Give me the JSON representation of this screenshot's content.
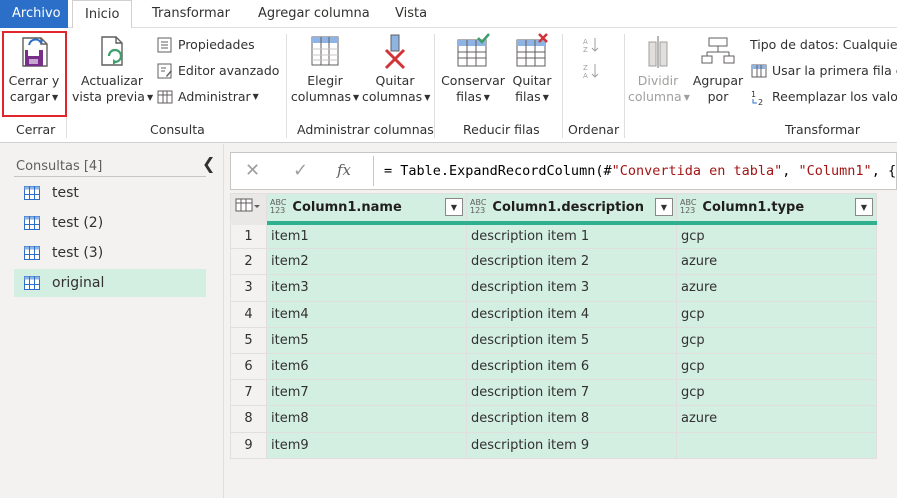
{
  "tabs": [
    {
      "label": "Archivo"
    },
    {
      "label": "Inicio"
    },
    {
      "label": "Transformar"
    },
    {
      "label": "Agregar columna"
    },
    {
      "label": "Vista"
    }
  ],
  "ribbon": {
    "close_load": {
      "line1": "Cerrar y",
      "line2": "cargar"
    },
    "refresh": {
      "line1": "Actualizar",
      "line2": "vista previa"
    },
    "properties": "Propiedades",
    "advanced_editor": "Editor avanzado",
    "manage": "Administrar",
    "choose_cols": {
      "line1": "Elegir",
      "line2": "columnas"
    },
    "remove_cols": {
      "line1": "Quitar",
      "line2": "columnas"
    },
    "keep_rows": {
      "line1": "Conservar",
      "line2": "filas"
    },
    "remove_rows": {
      "line1": "Quitar",
      "line2": "filas"
    },
    "split_col": {
      "line1": "Dividir",
      "line2": "columna"
    },
    "group_by": {
      "line1": "Agrupar",
      "line2": "por"
    },
    "data_type": "Tipo de datos: Cualquiera",
    "first_row_headers": "Usar la primera fila co",
    "replace_values": "Reemplazar los valore",
    "groups": {
      "close": "Cerrar",
      "query": "Consulta",
      "manage_cols": "Administrar columnas",
      "reduce_rows": "Reducir filas",
      "sort": "Ordenar",
      "transform": "Transformar"
    }
  },
  "queries": {
    "title": "Consultas [4]",
    "items": [
      {
        "label": "test"
      },
      {
        "label": "test (2)"
      },
      {
        "label": "test (3)"
      },
      {
        "label": "original"
      }
    ]
  },
  "formula": {
    "prefix": "= Table.ExpandRecordColumn(#",
    "str1": "\"Convertida en tabla\"",
    "mid": ", ",
    "str2": "\"Column1\"",
    "tail": ", {"
  },
  "grid": {
    "type_label_top": "ABC",
    "type_label_bottom": "123",
    "columns": [
      "Column1.name",
      "Column1.description",
      "Column1.type"
    ],
    "rows": [
      {
        "n": "1",
        "name": "item1",
        "description": "description item 1",
        "type": "gcp"
      },
      {
        "n": "2",
        "name": "item2",
        "description": "description item 2",
        "type": "azure"
      },
      {
        "n": "3",
        "name": "item3",
        "description": "description item 3",
        "type": "azure"
      },
      {
        "n": "4",
        "name": "item4",
        "description": "description item 4",
        "type": "gcp"
      },
      {
        "n": "5",
        "name": "item5",
        "description": "description item 5",
        "type": "gcp"
      },
      {
        "n": "6",
        "name": "item6",
        "description": "description item 6",
        "type": "gcp"
      },
      {
        "n": "7",
        "name": "item7",
        "description": "description item 7",
        "type": "gcp"
      },
      {
        "n": "8",
        "name": "item8",
        "description": "description item 8",
        "type": "azure"
      },
      {
        "n": "9",
        "name": "item9",
        "description": "description item 9",
        "type": ""
      }
    ]
  },
  "colors": {
    "file_tab": "#2b6fc9",
    "selection_green": "#d3efe1",
    "quality_bar": "#2fb08f",
    "highlight_red": "#e0262c"
  }
}
